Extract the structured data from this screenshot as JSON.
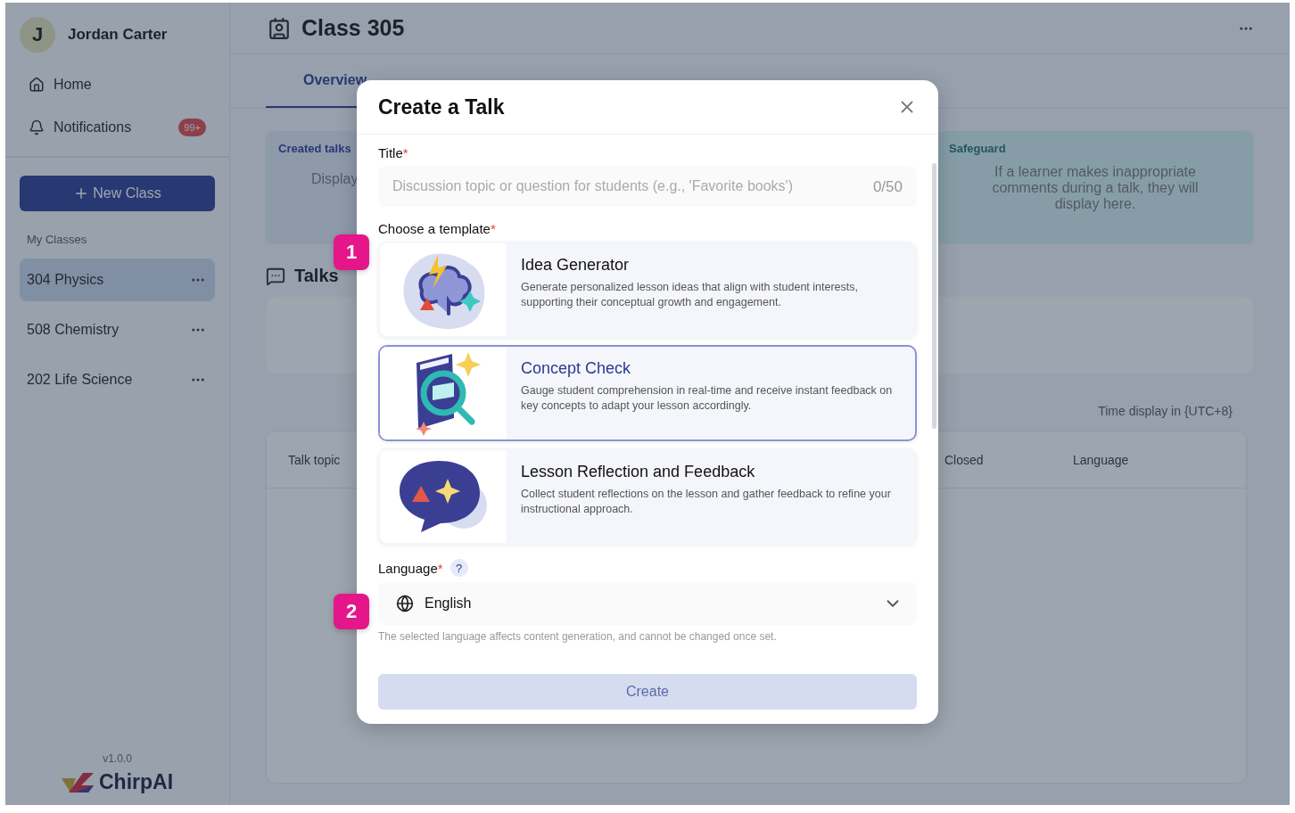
{
  "sidebar": {
    "user": {
      "initial": "J",
      "name": "Jordan Carter"
    },
    "nav": [
      {
        "kind": "home",
        "label": "Home"
      },
      {
        "kind": "bell",
        "label": "Notifications",
        "badge": "99+"
      }
    ],
    "new_class_button": "New Class",
    "section_label": "My Classes",
    "classes": [
      {
        "label": "304 Physics",
        "selected": true
      },
      {
        "label": "508 Chemistry",
        "selected": false
      },
      {
        "label": "202 Life Science",
        "selected": false
      }
    ],
    "version": "v1.0.0",
    "logo_text": "ChirpAI"
  },
  "header": {
    "title": "Class 305"
  },
  "tabs": [
    {
      "label": "Overview",
      "selected": true
    }
  ],
  "cards": [
    {
      "kind": "created",
      "title": "Created talks",
      "body": "Display"
    },
    {
      "kind": "safeguard",
      "title": "Safeguard",
      "body": "If a learner makes inappropriate comments during a talk, they will display here."
    }
  ],
  "talks_title": "Talks",
  "time_note": "Time display in {UTC+8}",
  "table": {
    "columns": [
      {
        "label": "Talk topic"
      },
      {
        "label": "Closed"
      },
      {
        "label": "Language"
      }
    ]
  },
  "modal": {
    "title": "Create a Talk",
    "title_field": {
      "label": "Title",
      "required": "*",
      "placeholder": "Discussion topic or question for students (e.g., 'Favorite books')",
      "counter": "0/50"
    },
    "template_label": "Choose a template",
    "template_required": "*",
    "templates": [
      {
        "kind": "idea",
        "name": "Idea Generator",
        "description": "Generate personalized lesson ideas that align with student interests, supporting their conceptual growth and engagement.",
        "selected": false
      },
      {
        "kind": "concept",
        "name": "Concept Check",
        "description": "Gauge student comprehension in real-time and receive instant feedback on key concepts to adapt your lesson accordingly.",
        "selected": true
      },
      {
        "kind": "reflection",
        "name": "Lesson Reflection and Feedback",
        "description": "Collect student reflections on the lesson and gather feedback to refine your instructional approach.",
        "selected": false
      }
    ],
    "language": {
      "label": "Language",
      "required": "*",
      "help": "?",
      "value": "English",
      "hint": "The selected language affects content generation, and cannot be changed once set."
    },
    "create_button": {
      "label": "Create",
      "disabled": true
    }
  },
  "markers": [
    {
      "label": "1"
    },
    {
      "label": "2"
    }
  ]
}
